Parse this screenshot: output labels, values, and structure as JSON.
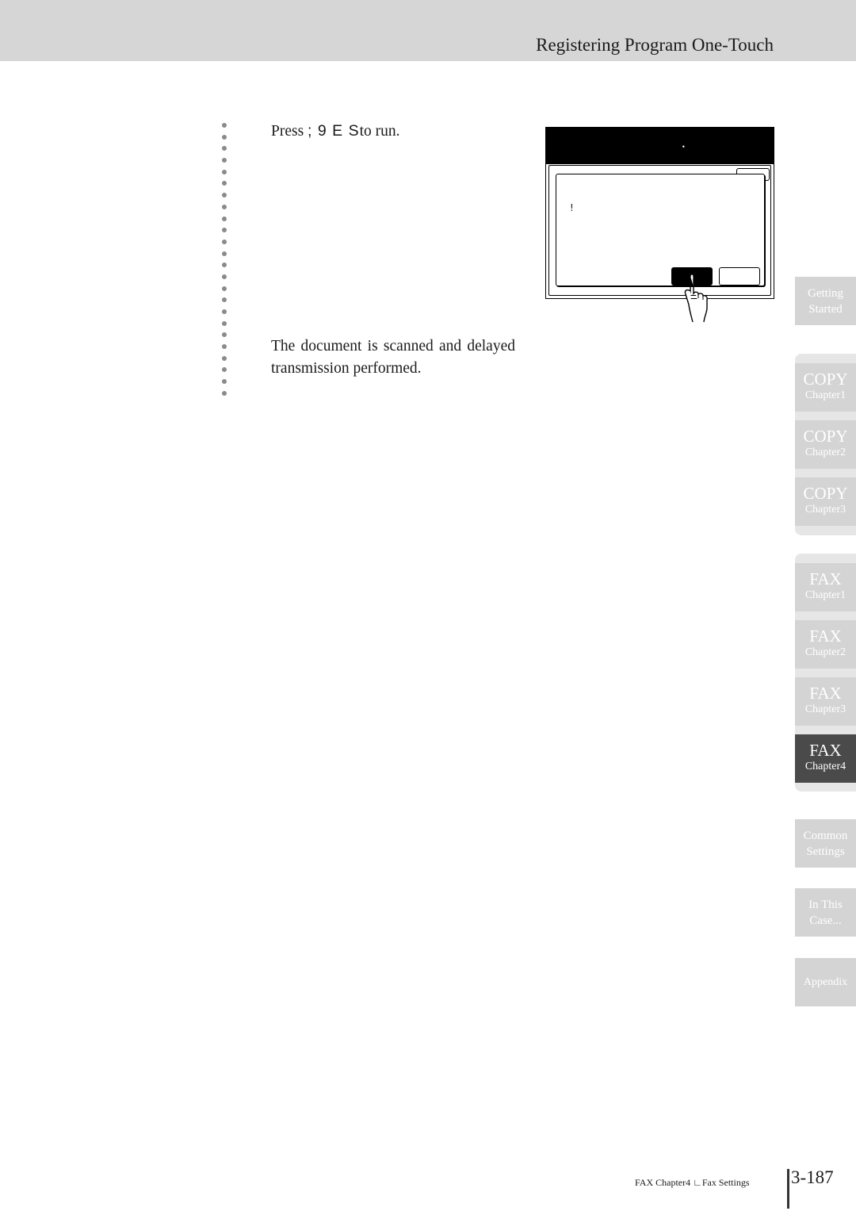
{
  "header": {
    "title": "Registering Program One-Touch"
  },
  "steps": [
    {
      "prefix": "Press ",
      "garbled": "; 9 E S",
      "suffix": "to run."
    },
    {
      "text": "The document is scanned and delayed transmission performed."
    }
  ],
  "illustration": {
    "screen_dot": "•",
    "dialog_mark": "!",
    "icon": "hand-pointer-icon"
  },
  "side_tabs": [
    {
      "line1": "Getting",
      "line2": "Started",
      "active": false
    },
    {
      "line1": "COPY",
      "line2": "Chapter1",
      "active": false
    },
    {
      "line1": "COPY",
      "line2": "Chapter2",
      "active": false
    },
    {
      "line1": "COPY",
      "line2": "Chapter3",
      "active": false
    },
    {
      "line1": "FAX",
      "line2": "Chapter1",
      "active": false
    },
    {
      "line1": "FAX",
      "line2": "Chapter2",
      "active": false
    },
    {
      "line1": "FAX",
      "line2": "Chapter3",
      "active": false
    },
    {
      "line1": "FAX",
      "line2": "Chapter4",
      "active": true
    },
    {
      "line1": "Common",
      "line2": "Settings",
      "active": false
    },
    {
      "line1": "In This",
      "line2": "Case...",
      "active": false
    },
    {
      "line1": "Appendix",
      "line2": "",
      "active": false
    }
  ],
  "footer": {
    "section": "FAX Chapter4  ∟Fax Settings",
    "page_number": "3-187"
  },
  "colors": {
    "header_band": "#d6d6d6",
    "tab_inactive": "#d4d4d4",
    "tab_active": "#4a4a4a",
    "tab_text": "#ffffff"
  }
}
